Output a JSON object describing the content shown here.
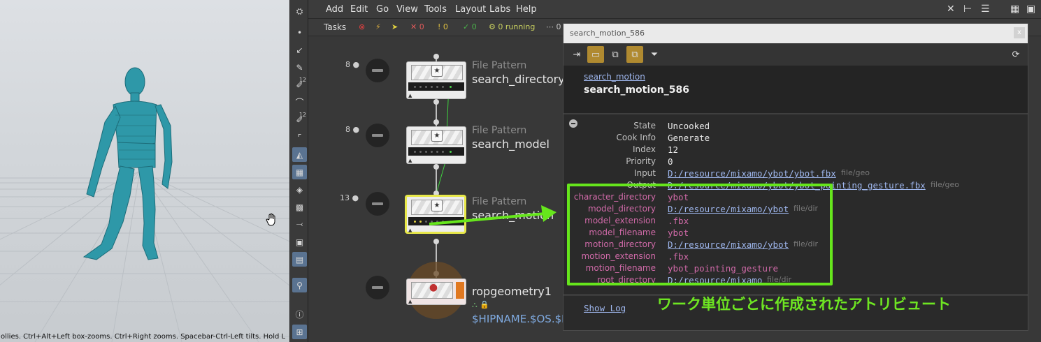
{
  "viewport": {
    "status_text": "ollies. Ctrl+Alt+Left box-zooms. Ctrl+Right zooms. Spacebar-Ctrl-Left tilts. Hold L",
    "hand_icon": "hand-cursor-icon"
  },
  "shelf": {
    "tools": [
      "view-tool-icon",
      "point-icon",
      "edit-curve-icon",
      "edit-pen-icon",
      "brush-12-icon",
      "paint-icon",
      "sculpt-12-icon",
      "segment-icon",
      "select-shader-icon",
      "checker-icon",
      "spotlight-icon",
      "landscape-icon",
      "cut-icon",
      "frame-icon",
      "image-view-icon",
      "location-pin-icon",
      "info-icon",
      "grid-layout-icon"
    ],
    "labels": {
      "brush": "12",
      "sculpt": "12"
    }
  },
  "menubar": {
    "items": [
      "Add",
      "Edit",
      "Go",
      "View",
      "Tools",
      "Layout",
      "Labs",
      "Help"
    ]
  },
  "taskbar": {
    "label": "Tasks",
    "errors": "0",
    "warnings": "0",
    "done": "0",
    "running": "0 running",
    "other": "0"
  },
  "nodes": [
    {
      "count": "8",
      "type": "File Pattern",
      "name": "search_directory"
    },
    {
      "count": "8",
      "type": "File Pattern",
      "name": "search_model"
    },
    {
      "count": "13",
      "type": "File Pattern",
      "name": "search_motion"
    },
    {
      "count": "",
      "type": "",
      "name": "ropgeometry1",
      "subtext": "$HIPNAME.$OS.$F"
    }
  ],
  "info": {
    "window_title": "search_motion_586",
    "close": "x",
    "node_link": "search_motion",
    "item_title": "search_motion_586",
    "general": [
      {
        "key": "State",
        "value": "Uncooked",
        "kind": "plain",
        "tag": ""
      },
      {
        "key": "Cook Info",
        "value": "Generate",
        "kind": "plain",
        "tag": ""
      },
      {
        "key": "Index",
        "value": "12",
        "kind": "plain",
        "tag": ""
      },
      {
        "key": "Priority",
        "value": "0",
        "kind": "plain",
        "tag": ""
      },
      {
        "key": "Input",
        "value": "D:/resource/mixamo/ybot/ybot.fbx",
        "kind": "path",
        "tag": "file/geo"
      },
      {
        "key": "Output",
        "value": "D:/resource/mixamo/ybot/ybot_pointing_gesture.fbx",
        "kind": "path",
        "tag": "file/geo"
      }
    ],
    "attributes": [
      {
        "key": "character_directory",
        "value": "ybot",
        "kind": "wi",
        "tag": ""
      },
      {
        "key": "model_directory",
        "value": "D:/resource/mixamo/ybot",
        "kind": "path",
        "tag": "file/dir"
      },
      {
        "key": "model_extension",
        "value": ".fbx",
        "kind": "wi",
        "tag": ""
      },
      {
        "key": "model_filename",
        "value": "ybot",
        "kind": "wi",
        "tag": ""
      },
      {
        "key": "motion_directory",
        "value": "D:/resource/mixamo/ybot",
        "kind": "path",
        "tag": "file/dir"
      },
      {
        "key": "motion_extension",
        "value": ".fbx",
        "kind": "wi",
        "tag": ""
      },
      {
        "key": "motion_filename",
        "value": "ybot_pointing_gesture",
        "kind": "wi",
        "tag": ""
      },
      {
        "key": "root_directory",
        "value": "D:/resource/mixamo",
        "kind": "path",
        "tag": "file/dir"
      }
    ],
    "show_log": "Show Log"
  },
  "annotation": {
    "text": "ワーク単位ごとに作成されたアトリビュート",
    "color": "#66e61c"
  }
}
